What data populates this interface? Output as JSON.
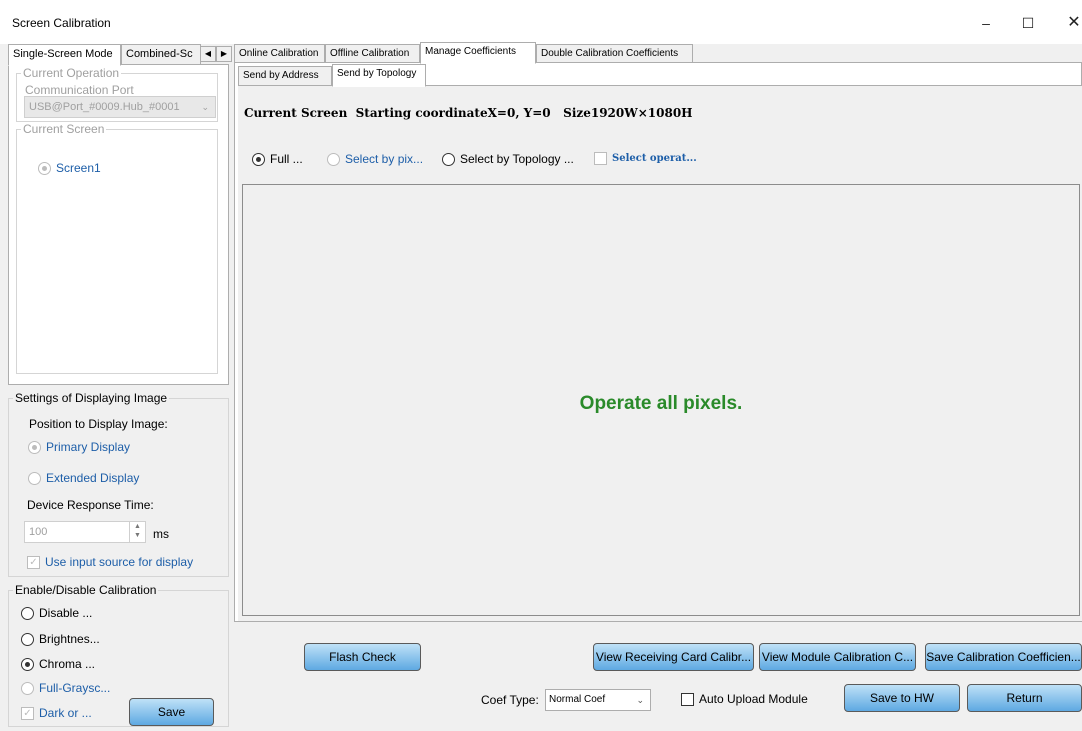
{
  "window": {
    "title": "Screen Calibration",
    "minimize": "–",
    "maximize": "☐",
    "close": "✕"
  },
  "left_tabs": [
    "Single-Screen Mode",
    "Combined-Sc"
  ],
  "current_operation": {
    "legend": "Current Operation",
    "port_label": "Communication Port",
    "port_value": "USB@Port_#0009.Hub_#0001"
  },
  "current_screen": {
    "legend": "Current Screen",
    "screen": "Screen1"
  },
  "display_settings": {
    "legend": "Settings of Displaying Image",
    "position_label": "Position to Display Image:",
    "primary": "Primary Display",
    "extended": "Extended Display",
    "response_label": "Device Response Time:",
    "response_value": "100",
    "response_unit": "ms",
    "use_input": "Use input source for display"
  },
  "calibration": {
    "legend": "Enable/Disable Calibration",
    "options": [
      "Disable ...",
      "Brightnes...",
      "Chroma ...",
      "Full-Graysc...",
      "Dark or ..."
    ],
    "save": "Save"
  },
  "tabs": [
    "Online Calibration",
    "Offline Calibration",
    "Manage Coefficients",
    "Double Calibration Coefficients"
  ],
  "sub_tabs": [
    "Send by Address",
    "Send by Topology"
  ],
  "screen_info": "Current Screen  Starting coordinateX=0, Y=0   Size1920W×1080H",
  "select_options": [
    "Full ...",
    "Select by pix...",
    "Select by Topology ...",
    "Select operat..."
  ],
  "canvas_message": "Operate all pixels.",
  "buttons": {
    "flash_check": "Flash Check",
    "view_receiving": "View Receiving Card Calibr...",
    "view_module": "View Module Calibration C...",
    "save_coef": "Save Calibration Coefficien...",
    "save_hw": "Save to HW",
    "return": "Return"
  },
  "coef_type": {
    "label": "Coef Type:",
    "value": "Normal Coef"
  },
  "auto_upload": "Auto Upload Module"
}
